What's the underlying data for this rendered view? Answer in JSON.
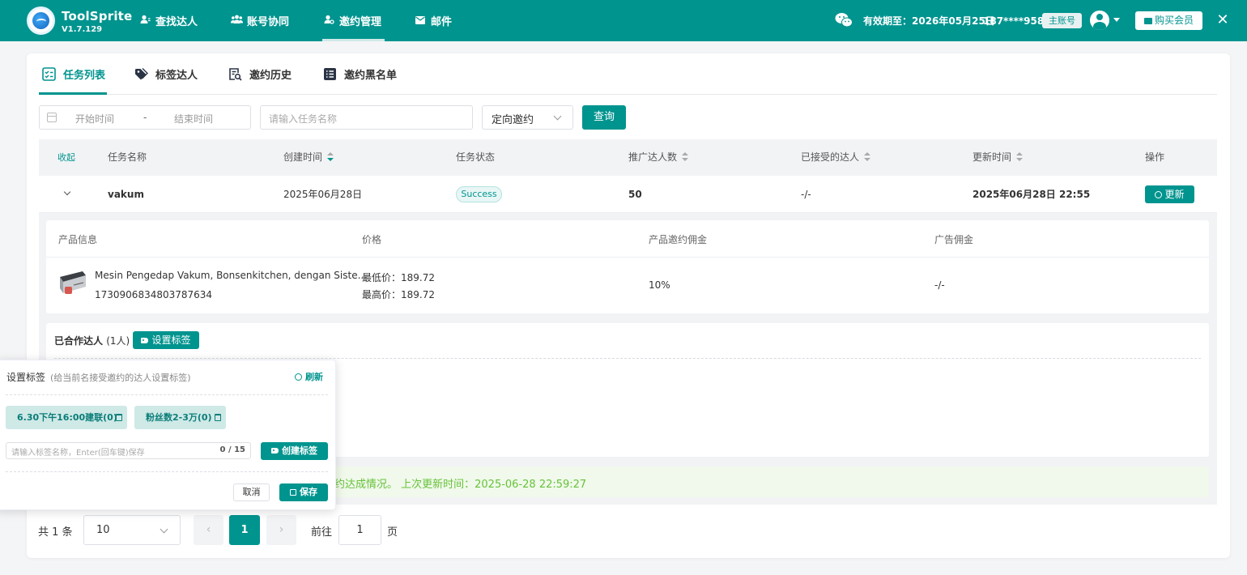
{
  "app": {
    "name": "ToolSprite",
    "version": "V1.7.129"
  },
  "nav": [
    {
      "label": "查找达人",
      "icon": "user-search-icon"
    },
    {
      "label": "账号协同",
      "icon": "users-icon"
    },
    {
      "label": "邀约管理",
      "icon": "user-gear-icon",
      "active": true
    },
    {
      "label": "邮件",
      "icon": "mail-icon"
    }
  ],
  "account": {
    "expiry": "有效期至：2026年05月25日",
    "phone": "187****9589",
    "role_badge": "主账号",
    "buy_label": "购买会员",
    "close_symbol": "✕"
  },
  "tabs": [
    {
      "label": "任务列表",
      "icon": "task-list-icon",
      "active": true
    },
    {
      "label": "标签达人",
      "icon": "tags-icon"
    },
    {
      "label": "邀约历史",
      "icon": "history-search-icon"
    },
    {
      "label": "邀约黑名单",
      "icon": "blacklist-icon"
    }
  ],
  "filters": {
    "start_placeholder": "开始时间",
    "range_sep": "-",
    "end_placeholder": "结束时间",
    "name_placeholder": "请输入任务名称",
    "type_selected": "定向邀约",
    "query_label": "查询"
  },
  "table": {
    "collapse_label": "收起",
    "headers": {
      "name": "任务名称",
      "created": "创建时间",
      "status": "任务状态",
      "promote_count": "推广达人数",
      "accepted": "已接受的达人",
      "updated": "更新时间",
      "action": "操作"
    },
    "row": {
      "name": "vakum",
      "created": "2025年06月28日",
      "status": "Success",
      "promote_count": "50",
      "accepted": "-/-",
      "updated": "2025年06月28日 22:55",
      "action_label": "更新"
    }
  },
  "product": {
    "headers": {
      "info": "产品信息",
      "price": "价格",
      "commission": "产品邀约佣金",
      "ad_commission": "广告佣金"
    },
    "name": "Mesin Pengedap Vakum, Bonsenkitchen, dengan Siste...",
    "id": "1730906834803787634",
    "min_price": "最低价：189.72",
    "max_price": "最高价：189.72",
    "commission": "10%",
    "ad_commission": "-/-"
  },
  "cooperated": {
    "title": "已合作达人",
    "count": "(1人)",
    "set_tag_label": "设置标签"
  },
  "notice": "约达成情况。 上次更新时间：2025-06-28 22:59:27",
  "pagination": {
    "total": "共 1 条",
    "page_size": "10",
    "prev": "‹",
    "current": "1",
    "next": "›",
    "goto_label": "前往",
    "goto_value": "1",
    "page_suffix": "页"
  },
  "tag_popover": {
    "title": "设置标签",
    "subtitle": "(给当前名接受邀约的达人设置标签)",
    "refresh_label": "刷新",
    "tags": [
      "6.30下午16:00建联(0)",
      "粉丝数2-3万(0)"
    ],
    "input_placeholder": "请输入标签名称，Enter(回车键)保存",
    "input_count": "0 / 15",
    "create_label": "创建标签",
    "cancel_label": "取消",
    "save_label": "保存"
  },
  "colors": {
    "primary": "#00948f",
    "success_text": "#67c23a",
    "success_bg": "#f0f9eb"
  }
}
